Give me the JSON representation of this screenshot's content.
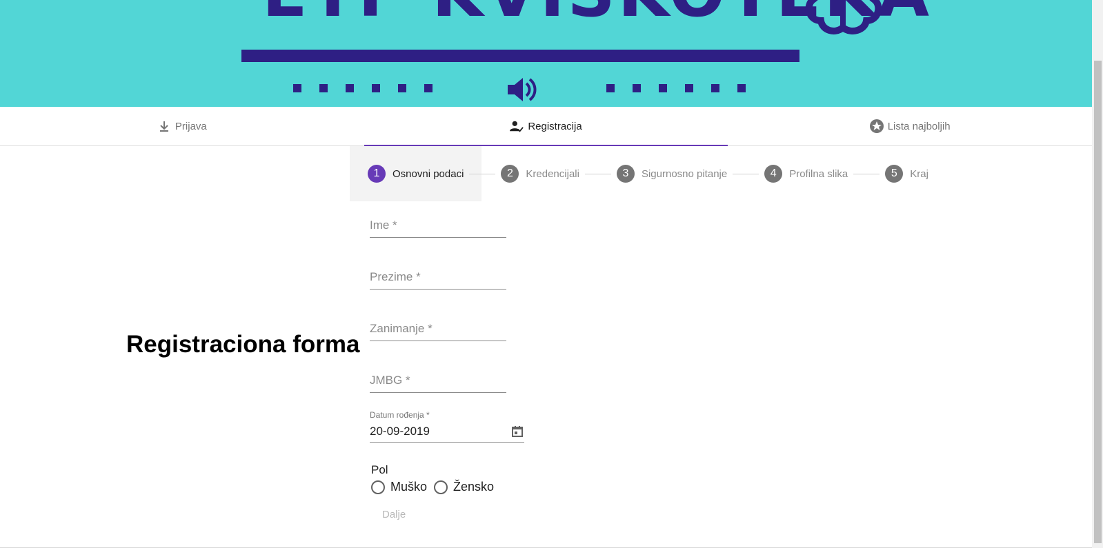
{
  "banner": {
    "title": "ETF KVISKOTEKA",
    "colors": {
      "background": "#52d6d6",
      "accent": "#2e1f84"
    },
    "icons": [
      "brain-icon",
      "speaker-icon"
    ]
  },
  "tabs": [
    {
      "label": "Prijava",
      "icon": "download-icon",
      "active": false
    },
    {
      "label": "Registracija",
      "icon": "person-check-icon",
      "active": true
    },
    {
      "label": "Lista najboljih",
      "icon": "star-circle-icon",
      "active": false
    }
  ],
  "stepper": [
    {
      "number": "1",
      "label": "Osnovni podaci",
      "active": true
    },
    {
      "number": "2",
      "label": "Kredencijali",
      "active": false
    },
    {
      "number": "3",
      "label": "Sigurnosno pitanje",
      "active": false
    },
    {
      "number": "4",
      "label": "Profilna slika",
      "active": false
    },
    {
      "number": "5",
      "label": "Kraj",
      "active": false
    }
  ],
  "page": {
    "title": "Registraciona forma"
  },
  "form": {
    "ime": {
      "placeholder": "Ime *",
      "value": ""
    },
    "prezime": {
      "placeholder": "Prezime *",
      "value": ""
    },
    "zanimanje": {
      "placeholder": "Zanimanje *",
      "value": ""
    },
    "jmbg": {
      "placeholder": "JMBG *",
      "value": ""
    },
    "datum": {
      "label": "Datum rođenja *",
      "value": "20-09-2019"
    },
    "pol": {
      "label": "Pol",
      "options": [
        "Muško",
        "Žensko"
      ],
      "selected": null
    },
    "next_label": "Dalje"
  },
  "accent_color": "#673ab7"
}
